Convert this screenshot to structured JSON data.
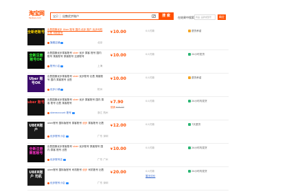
{
  "header": {
    "logo_zh": "淘宝网",
    "logo_en": "Taobao.com",
    "search_type": "宝贝",
    "search_query": "出售优步账户",
    "search_button": "搜 索",
    "sub_label": "在结果中搜索",
    "sub_placeholder": "商品, 品牌或型号",
    "sub_button": "确定"
  },
  "colors": {
    "accent": "#ff5000",
    "link": "#3366cc"
  },
  "rows": [
    {
      "thumb_text": "全新老账号",
      "thumb_bg": "#111111",
      "thumb_fg": "#ffd600",
      "title_pre": "出售国服优步 ",
      "title_hl": "Uber",
      "title_post": " 账号 国内 优步 账户 优步司机 出售 司机账号",
      "title_link": true,
      "shop": "旗舰店铺",
      "location": "北京",
      "price_yen": "¥",
      "price": "10.00",
      "price_tag": "",
      "promo_text": "",
      "promo_value": "",
      "promo_orig": "",
      "sales": "0人付款",
      "reviews": "",
      "service_icon": "shield",
      "service": "退货承诺"
    },
    {
      "thumb_text": "全新注册 账号OK",
      "thumb_bg": "#0a0a0a",
      "thumb_fg": "#33ff33",
      "title_pre": "出售国服优步乘客账号 ",
      "title_hl": "uber",
      "title_post": " 优步 乘客 账号 国内 账号 乘客账号 乘客账号 注册账号",
      "title_link": false,
      "shop": "账号小店",
      "location": "上海",
      "price_yen": "¥",
      "price": "10.00",
      "price_tag": "",
      "promo_text": "",
      "promo_value": "",
      "promo_orig": "",
      "sales": "0人付款",
      "reviews": "",
      "service_icon": "clock",
      "service": "24小时发货"
    },
    {
      "thumb_text": "Uber 账号OK",
      "thumb_bg": "#3a0a6a",
      "thumb_fg": "#ffffff",
      "title_pre": "出售国服优步乘客账号 ",
      "title_hl": "uber",
      "title_post": " 优步账号 出售 乘客账号 国内 乘客账号 出售",
      "title_link": false,
      "shop": "优步小铺",
      "location": "杭州",
      "price_yen": "¥",
      "price": "10.00",
      "price_tag": "",
      "promo_text": "",
      "promo_value": "",
      "promo_orig": "",
      "sales": "0人付款",
      "reviews": "",
      "service_icon": "shield",
      "service": "退货承诺"
    },
    {
      "thumb_text": "uber 账号",
      "thumb_bg": "#111111",
      "thumb_fg": "#ff3b3b",
      "title_pre": "出售国服优步乘客账号 ",
      "title_hl": "uber",
      "title_post": " 优步 乘客账号 国内 乘客 账号 出售 乘客账号",
      "title_link": false,
      "shop": "uberaccount 账号",
      "location": "浙江 杭州",
      "price_yen": "¥",
      "price": "7.90",
      "price_tag": "",
      "promo_text": "促销",
      "promo_value": "",
      "promo_orig": "¥15.00",
      "sales": "0人付款",
      "reviews": "",
      "service_icon": "clock",
      "service": "24小时内发货"
    },
    {
      "thumb_text": "UBER账户",
      "thumb_bg": "#1a1a1a",
      "thumb_fg": "#ffffff",
      "title_pre": "uber账号 国际版账号 乘客账号 ",
      "title_hl": "优步",
      "title_post": " 乘客账号 出售",
      "title_link": false,
      "shop": "优步账号小店",
      "location": "广东 深圳",
      "price_yen": "¥",
      "price": "12.00",
      "price_tag": "",
      "promo_text": "",
      "promo_value": "",
      "promo_orig": "",
      "sales": "0人付款",
      "reviews": "",
      "service_icon": "seven",
      "service": "7天退货"
    },
    {
      "thumb_text": "全新注册 乘客账号",
      "thumb_bg": "#0a0a0a",
      "thumb_fg": "#ff33cc",
      "title_pre": "出售国服优步乘客账号 ",
      "title_hl": "uber",
      "title_post": " 优步账号 乘客账号 国内 乘客 账号 出售",
      "title_link": false,
      "shop": "优步账号店",
      "location": "广东 广州",
      "price_yen": "¥",
      "price": "10.00",
      "price_tag": "",
      "promo_text": "",
      "promo_value": "",
      "promo_orig": "",
      "sales": "0人付款",
      "reviews": "",
      "service_icon": "clock",
      "service": "24小时内发货"
    },
    {
      "thumb_text": "UBER账户 司机",
      "thumb_bg": "#1a1a1a",
      "thumb_fg": "#ffffff",
      "title_pre": "uber账号 国际版账号 司机账号 ",
      "title_hl": "优步",
      "title_post": " 司机账号 出售",
      "title_link": false,
      "shop": "优步账号小店",
      "location": "广东 深圳",
      "price_yen": "¥",
      "price": "20.00",
      "price_tag": "",
      "promo_text": "",
      "promo_value": "",
      "promo_orig": "",
      "sales": "0人付款",
      "reviews": "暂无评价",
      "service_icon": "clock",
      "service": "24小时内发货"
    }
  ]
}
